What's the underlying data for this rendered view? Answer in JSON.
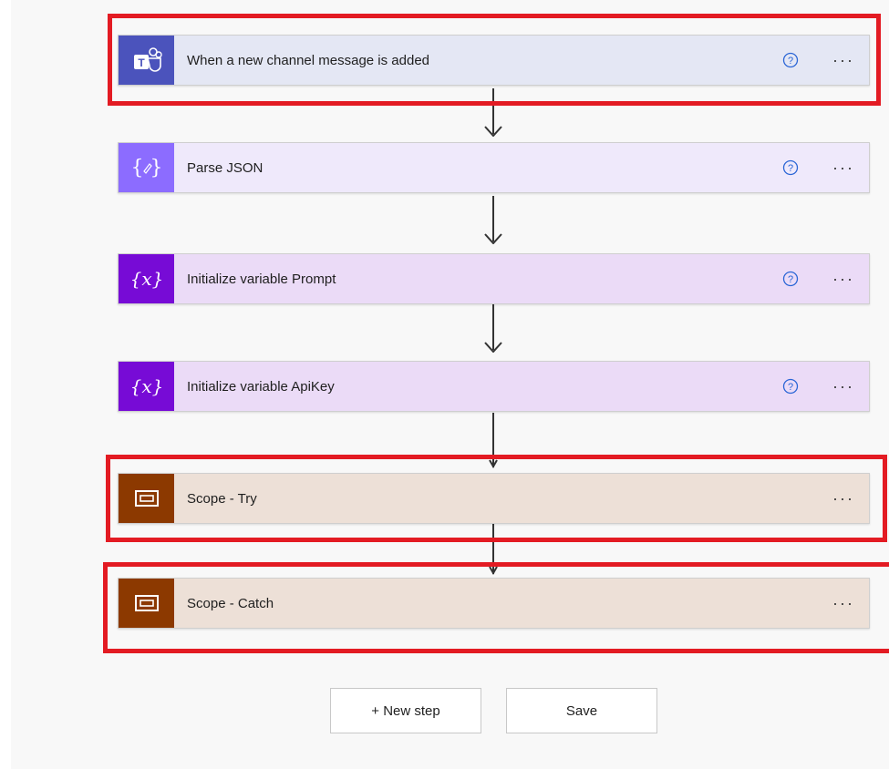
{
  "steps": [
    {
      "title": "When a new channel message is added",
      "icon": "teams-icon",
      "icon_color": "#4b53bc",
      "bg": "#e4e7f4",
      "help": true
    },
    {
      "title": "Parse JSON",
      "icon": "data-operation-icon",
      "icon_color": "#8c6cff",
      "bg": "#efe9fb",
      "help": true
    },
    {
      "title": "Initialize variable Prompt",
      "icon": "variable-icon",
      "icon_color": "#770bd6",
      "bg": "#ebdbf7",
      "help": true
    },
    {
      "title": "Initialize variable ApiKey",
      "icon": "variable-icon",
      "icon_color": "#770bd6",
      "bg": "#ebdbf7",
      "help": true
    },
    {
      "title": "Scope - Try",
      "icon": "scope-icon",
      "icon_color": "#8c3900",
      "bg": "#ede0d7",
      "help": false
    },
    {
      "title": "Scope - Catch",
      "icon": "scope-icon",
      "icon_color": "#8c3900",
      "bg": "#ede0d7",
      "help": false
    }
  ],
  "more_label": "···",
  "actions": {
    "new_step_label": "+ New step",
    "save_label": "Save"
  },
  "highlight_color": "#e31b23"
}
